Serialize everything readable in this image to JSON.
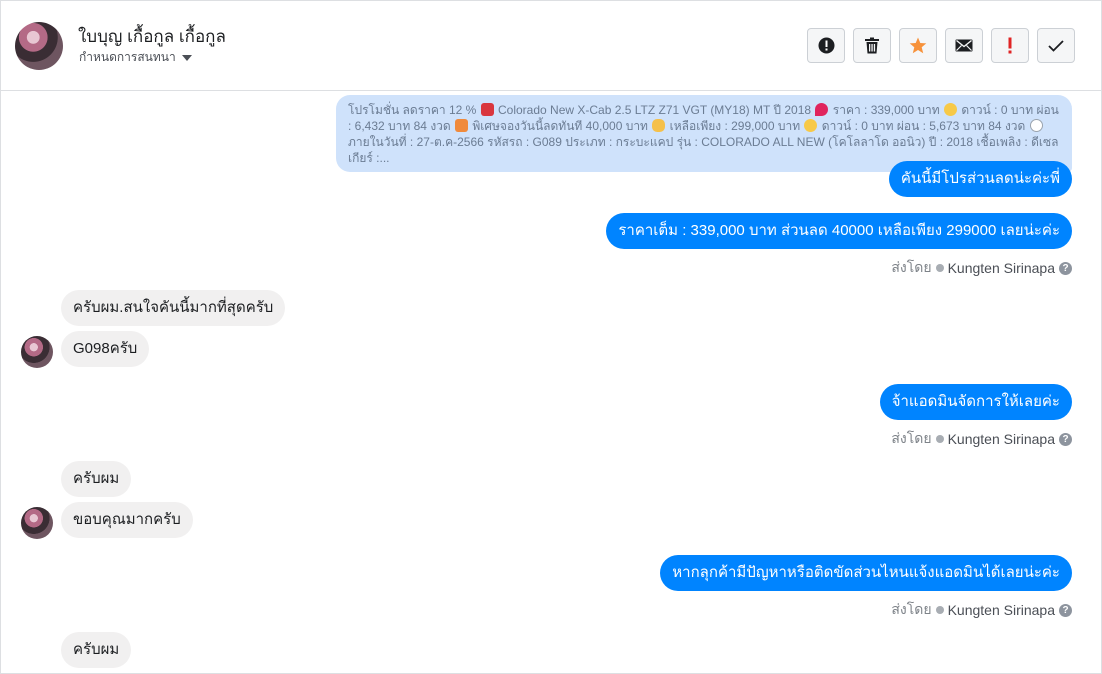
{
  "header": {
    "name": "ใบบุญ เกื้อกูล เกื้อกูล",
    "status": "กำหนดการสนทนา",
    "action_icons": [
      "alert-circle-icon",
      "trash-icon",
      "star-icon",
      "mail-icon",
      "exclamation-icon",
      "check-icon"
    ],
    "star_color": "#f7923b",
    "exclamation_color": "#e02424"
  },
  "promo": {
    "parts": [
      "โปรโมชั่น ลดราคา 12 % ",
      " Colorado New X-Cab 2.5 LTZ Z71 VGT (MY18) MT ปี 2018 ",
      " ราคา : 339,000 บาท ",
      " ดาวน์ : 0 บาท ผ่อน : 6,432 บาท 84 งวด ",
      " พิเศษจองวันนี้ลดทันที 40,000 บาท ",
      " เหลือเพียง : 299,000 บาท ",
      " ดาวน์ : 0 บาท ผ่อน : 5,673 บาท 84 งวด ",
      " ภายในวันที่ : 27-ต.ค-2566 รหัสรถ : G089 ประเภท : กระบะแคป รุ่น : COLORADO ALL NEW (โคโลลาโด ออนิว) ปี : 2018 เชื้อเพลิง : ดีเซล เกียร์ :..."
    ]
  },
  "messages": {
    "m1": "คันนี้มีโปรส่วนลดน่ะค่ะพี่",
    "m2": "ราคาเต็ม : 339,000 บาท ส่วนลด 40000 เหลือเพียง 299000 เลยน่ะค่ะ",
    "m3": "ครับผม.สนใจคันนี้มากที่สุดครับ",
    "m4": "G098ครับ",
    "m5": "จ้าแอดมินจัดการให้เลยค่ะ",
    "m6": "ครับผม",
    "m7": "ขอบคุณมากครับ",
    "m8": "หากลุกค้ามีปัญหาหรือติดขัดส่วนไหนแจ้งแอดมินได้เลยน่ะค่ะ",
    "m9": "ครับผม"
  },
  "sent_by": {
    "label": "ส่งโดย",
    "name": "Kungten Sirinapa",
    "help": "?"
  },
  "colors": {
    "outgoing": "#0084ff",
    "incoming": "#f1f0f0",
    "promo": "#cfe2fb"
  }
}
